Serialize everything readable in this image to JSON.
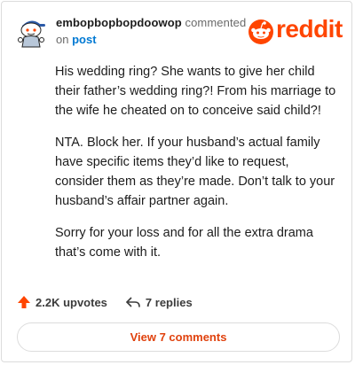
{
  "comment": {
    "author": "embopbopbopdoowop",
    "action_text": "commented",
    "on_text": "on",
    "post_link": "post",
    "paragraphs": [
      "His wedding ring? She wants to give her child their father’s wedding ring?! From his marriage to the wife he cheated on to conceive said child?!",
      "NTA. Block her. If your husband’s actual family have specific items they’d like to request, consider them as they’re made. Don’t talk to your husband’s affair partner again.",
      "Sorry for your loss and for all the extra drama that’s come with it."
    ]
  },
  "brand": {
    "logo_text": "reddit",
    "color": "#ff4500"
  },
  "actions": {
    "upvotes": "2.2K upvotes",
    "replies": "7 replies"
  },
  "view_button": {
    "label": "View 7 comments"
  },
  "icons": {
    "avatar": "snoo-avatar-icon",
    "upvote": "upvote-arrow-icon",
    "reply": "reply-arrow-icon",
    "logo": "reddit-snoo-icon"
  }
}
